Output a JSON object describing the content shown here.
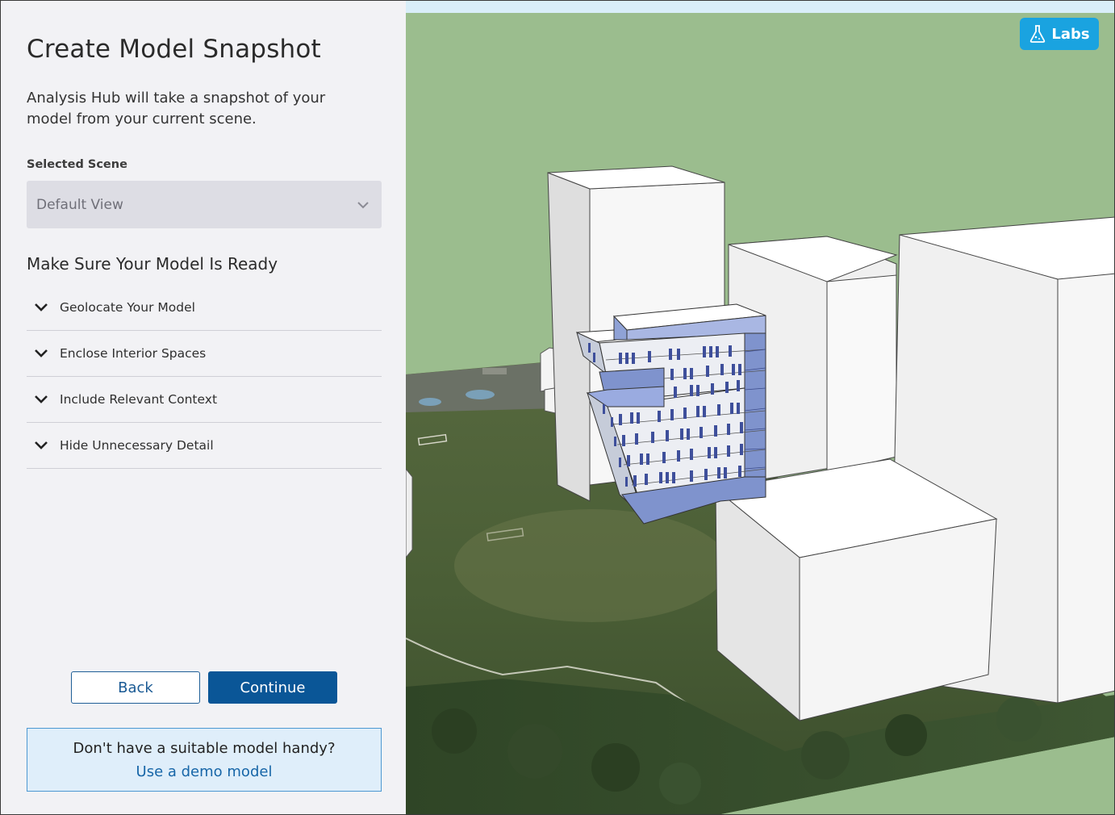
{
  "panel": {
    "title": "Create Model Snapshot",
    "description": "Analysis Hub will take a snapshot of your model from your current scene.",
    "scene_label": "Selected Scene",
    "scene_value": "Default View",
    "ready_title": "Make Sure Your Model Is Ready",
    "checklist": [
      {
        "label": "Geolocate Your Model"
      },
      {
        "label": "Enclose Interior Spaces"
      },
      {
        "label": "Include Relevant Context"
      },
      {
        "label": "Hide Unnecessary Detail"
      }
    ],
    "back_label": "Back",
    "continue_label": "Continue",
    "demo_question": "Don't have a suitable model handy?",
    "demo_link": "Use a demo model"
  },
  "viewport": {
    "labs_label": "Labs",
    "labs_icon": "flask-icon"
  },
  "colors": {
    "accent": "#0a5697",
    "labs": "#1aa3e0",
    "panel_bg": "#f2f2f5",
    "ground": "#9bbd8e"
  }
}
